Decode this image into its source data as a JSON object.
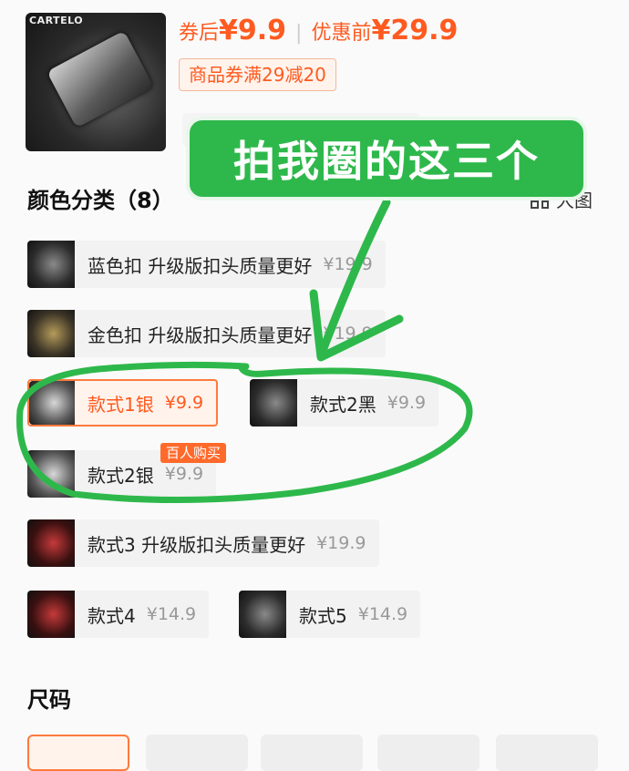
{
  "product": {
    "brand_on_image": "CARTELO",
    "after_coupon_label": "券后",
    "after_coupon_price": "¥9.9",
    "before_label": "优惠前",
    "before_price": "¥29.9",
    "coupon": "商品券满29减20"
  },
  "color_section": {
    "title": "颜色分类（8）",
    "big_view": "大图",
    "options": [
      {
        "name": "蓝色扣 升级版扣头质量更好",
        "price": "¥19.9"
      },
      {
        "name": "金色扣 升级版扣头质量更好",
        "price": "¥19.9"
      },
      {
        "name": "款式1银",
        "price": "¥9.9",
        "selected": true
      },
      {
        "name": "款式2黑",
        "price": "¥9.9"
      },
      {
        "name": "款式2银",
        "price": "¥9.9",
        "badge": "百人购买"
      },
      {
        "name": "款式3 升级版扣头质量更好",
        "price": "¥19.9"
      },
      {
        "name": "款式4",
        "price": "¥14.9"
      },
      {
        "name": "款式5",
        "price": "¥14.9"
      }
    ]
  },
  "size_section": {
    "title": "尺码"
  },
  "annotation": {
    "text": "拍我圈的这三个",
    "color": "#2eb84b"
  },
  "colors": {
    "accent": "#ff5a1f",
    "annotation_green": "#2eb84b"
  }
}
